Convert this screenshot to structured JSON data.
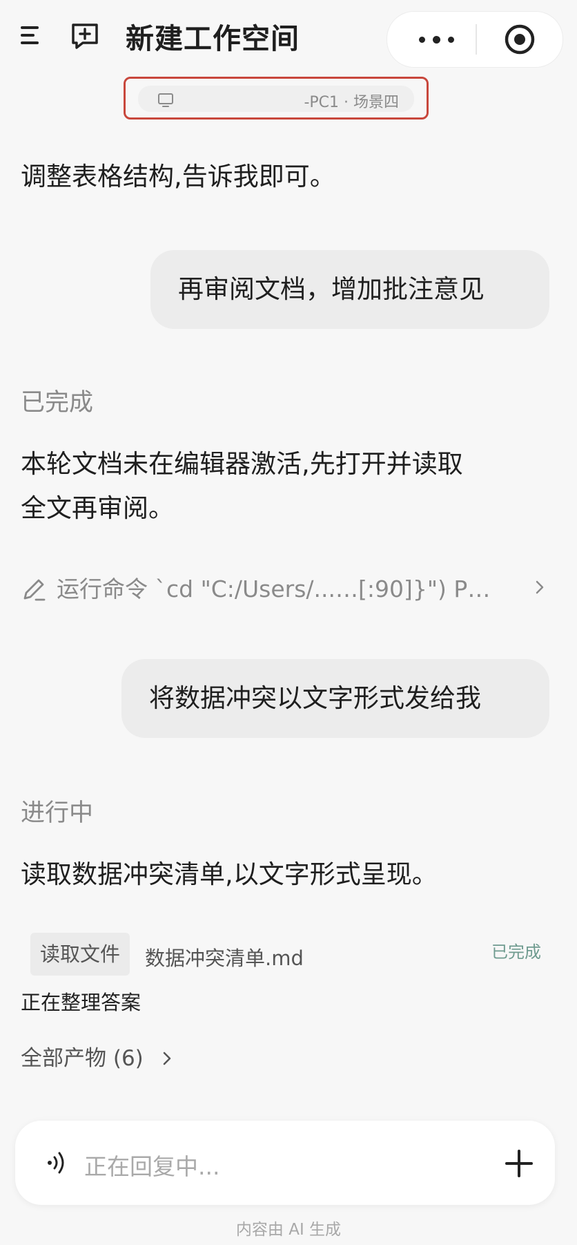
{
  "header": {
    "title": "新建工作空间",
    "menu_icon": "menu-icon",
    "new_icon": "new-workspace-icon",
    "more_icon": "more-icon",
    "target_icon": "record-target-icon"
  },
  "device": {
    "label": "-PC1 · 场景四",
    "icon": "monitor-icon",
    "highlight_color": "#c8473c"
  },
  "conversation": {
    "intro_text": "调整表格结构,告诉我即可。",
    "user_message_1": "再审阅文档，增加批注意见",
    "status_1": "已完成",
    "reply_1_line1": "本轮文档未在编辑器激活,先打开并读取",
    "reply_1_line2": "全文再审阅。",
    "command": {
      "icon": "pencil-icon",
      "text": "运行命令 `cd \"C:/Users/...…[:90]}\") P…"
    },
    "user_message_2": "将数据冲突以文字形式发给我",
    "status_2": "进行中",
    "reply_2": "读取数据冲突清单,以文字形式呈现。",
    "file_action": {
      "tag": "读取文件",
      "file_name": "数据冲突清单.md",
      "status": "已完成",
      "status_color": "#6f9b8f"
    },
    "working_text": "正在整理答案",
    "artifacts_link": "全部产物 (6)"
  },
  "input": {
    "placeholder": "正在回复中...",
    "voice_icon": "voice-icon",
    "plus_icon": "plus-icon"
  },
  "footer": {
    "disclaimer": "内容由 AI 生成"
  }
}
